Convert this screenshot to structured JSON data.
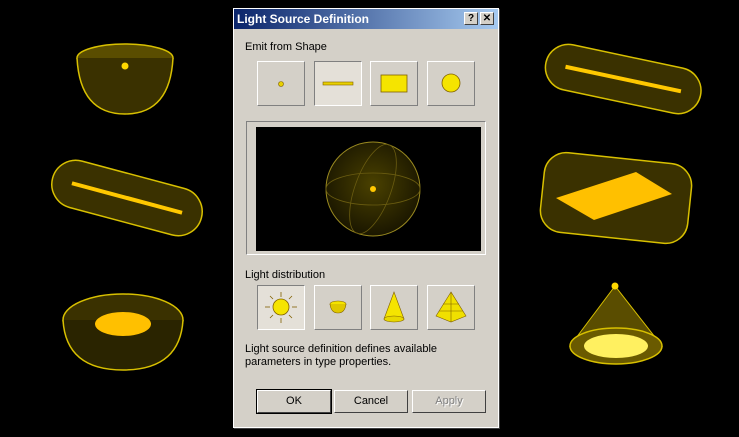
{
  "dialog": {
    "title": "Light Source Definition",
    "help_label": "?",
    "close_label": "✕",
    "emit_label": "Emit from Shape",
    "emit_shapes": [
      "point",
      "line",
      "rectangle",
      "sphere"
    ],
    "selected_shape": "line",
    "distribution_label": "Light distribution",
    "distributions": [
      "hemispherical",
      "hemisphere-cup",
      "spot",
      "photometric-web"
    ],
    "selected_distribution": "hemispherical",
    "description": [
      "Light source definition defines available",
      "parameters in type properties."
    ],
    "ok_label": "OK",
    "cancel_label": "Cancel",
    "apply_label": "Apply"
  },
  "colors": {
    "accent": "#ffe000",
    "title_start": "#0a246a",
    "title_end": "#a6caf0",
    "face": "#d4d0c8"
  }
}
